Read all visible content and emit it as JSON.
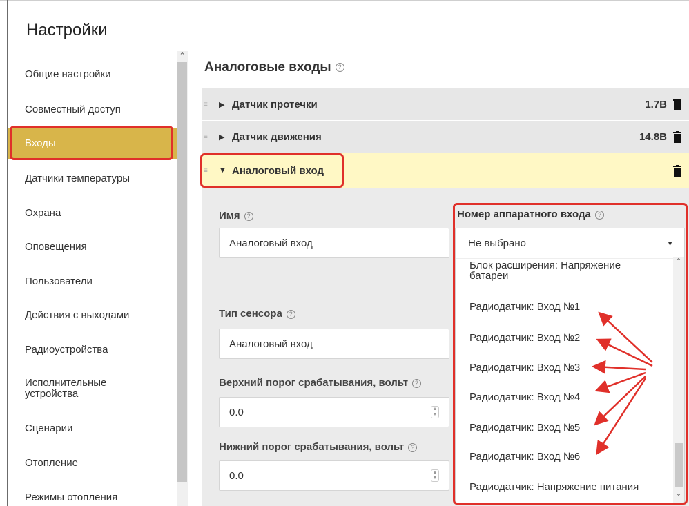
{
  "app": {
    "title": "Настройки"
  },
  "sidebar": {
    "items": [
      {
        "label": "Общие настройки"
      },
      {
        "label": "Совместный доступ"
      },
      {
        "label": "Входы"
      },
      {
        "label": "Датчики температуры"
      },
      {
        "label": "Охрана"
      },
      {
        "label": "Оповещения"
      },
      {
        "label": "Пользователи"
      },
      {
        "label": "Действия с выходами"
      },
      {
        "label": "Радиоустройства"
      },
      {
        "label": "Исполнительные устройства"
      },
      {
        "label": "Сценарии"
      },
      {
        "label": "Отопление"
      },
      {
        "label": "Режимы отопления"
      }
    ],
    "active_index": 2
  },
  "main": {
    "section_title": "Аналоговые входы",
    "panels": [
      {
        "label": "Датчик протечки",
        "value": "1.7В"
      },
      {
        "label": "Датчик движения",
        "value": "14.8В"
      },
      {
        "label": "Аналоговый вход",
        "value": ""
      }
    ],
    "form": {
      "name_label": "Имя",
      "name_value": "Аналоговый вход",
      "sensor_type_label": "Тип сенсора",
      "sensor_type_value": "Аналоговый вход",
      "upper_threshold_label": "Верхний порог срабатывания, вольт",
      "upper_threshold_value": "0.0",
      "lower_threshold_label": "Нижний порог срабатывания, вольт",
      "lower_threshold_value": "0.0",
      "hw_input_label": "Номер аппаратного входа",
      "hw_input_selected": "Не выбрано",
      "hw_input_options": [
        "Блок расширения: Напряжение батареи",
        "Радиодатчик: Вход №1",
        "Радиодатчик: Вход №2",
        "Радиодатчик: Вход №3",
        "Радиодатчик: Вход №4",
        "Радиодатчик: Вход №5",
        "Радиодатчик: Вход №6",
        "Радиодатчик: Напряжение питания"
      ]
    }
  },
  "colors": {
    "active_sidebar": "#d8b54a",
    "open_panel": "#fff8c5",
    "highlight_red": "#e0302a"
  },
  "icons": {
    "help": "question-circle-icon",
    "trash": "trash-icon",
    "caret_right": "caret-right-icon",
    "caret_down": "caret-down-icon"
  }
}
